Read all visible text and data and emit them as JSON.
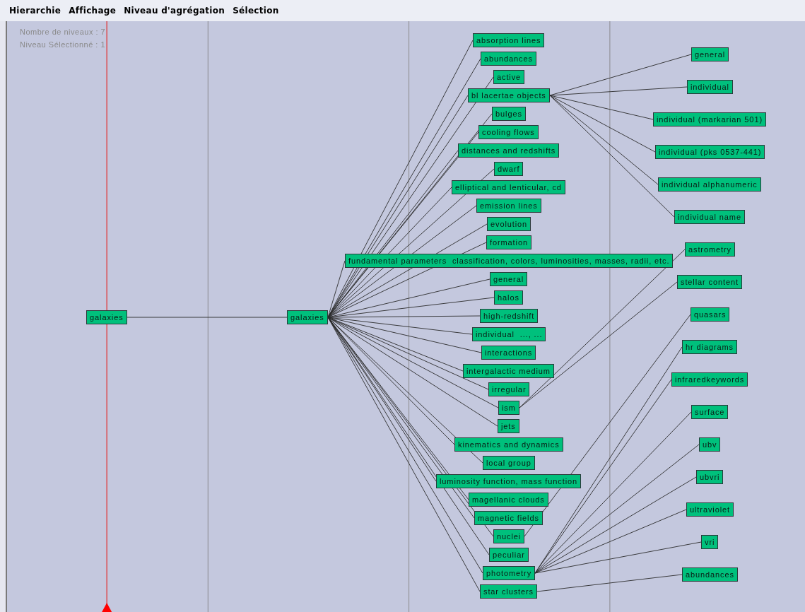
{
  "menu_bar": [
    {
      "label": "Hierarchie"
    },
    {
      "label": "Affichage"
    },
    {
      "label": "Niveau d'agrégation"
    },
    {
      "label": "Sélection"
    }
  ],
  "info": [
    "Nombre de niveaux : 7",
    "Niveau Sélectionné : 1"
  ],
  "tree": {
    "label": "galaxies",
    "children": [
      {
        "label": "galaxies",
        "children": [
          {
            "label": "absorption lines"
          },
          {
            "label": "abundances"
          },
          {
            "label": "active"
          },
          {
            "label": "bl lacertae objects",
            "children": [
              {
                "label": "general"
              },
              {
                "label": "individual"
              },
              {
                "label": "individual (markarian 501)"
              },
              {
                "label": "individual (pks 0537-441)"
              },
              {
                "label": "individual alphanumeric"
              },
              {
                "label": "individual name"
              }
            ]
          },
          {
            "label": "bulges"
          },
          {
            "label": "cooling flows"
          },
          {
            "label": "distances and redshifts"
          },
          {
            "label": "dwarf"
          },
          {
            "label": "elliptical and lenticular, cd"
          },
          {
            "label": "emission lines"
          },
          {
            "label": "evolution"
          },
          {
            "label": "formation"
          },
          {
            "label": "fundamental parameters  classification, colors, luminosities, masses, radii, etc."
          },
          {
            "label": "general"
          },
          {
            "label": "halos"
          },
          {
            "label": "high-redshift"
          },
          {
            "label": "individual  ..., ..."
          },
          {
            "label": "interactions"
          },
          {
            "label": "intergalactic medium"
          },
          {
            "label": "irregular"
          },
          {
            "label": "ism",
            "children": [
              {
                "label": "astrometry"
              },
              {
                "label": "stellar content"
              }
            ]
          },
          {
            "label": "jets"
          },
          {
            "label": "kinematics and dynamics"
          },
          {
            "label": "local group"
          },
          {
            "label": "luminosity function, mass function"
          },
          {
            "label": "magellanic clouds"
          },
          {
            "label": "magnetic fields"
          },
          {
            "label": "nuclei",
            "children": [
              {
                "label": "quasars"
              }
            ]
          },
          {
            "label": "peculiar"
          },
          {
            "label": "photometry",
            "children": [
              {
                "label": "hr diagrams"
              },
              {
                "label": "infraredkeywords"
              },
              {
                "label": "surface"
              },
              {
                "label": "ubv"
              },
              {
                "label": "ubvri"
              },
              {
                "label": "ultraviolet"
              },
              {
                "label": "vri"
              }
            ]
          },
          {
            "label": "star clusters",
            "children": [
              {
                "label": "abundances"
              }
            ]
          }
        ]
      }
    ]
  }
}
